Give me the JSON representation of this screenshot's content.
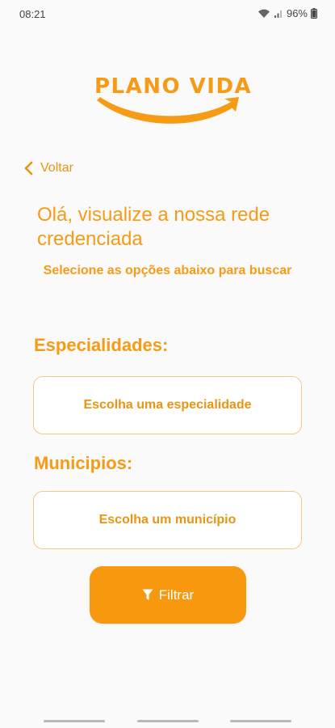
{
  "status_bar": {
    "time": "08:21",
    "battery": "96%",
    "icons": [
      "wifi-icon",
      "signal-icon",
      "battery-icon"
    ]
  },
  "logo": {
    "text": "PLANO VIDA"
  },
  "back": {
    "label": "Voltar",
    "icon": "chevron-left-icon"
  },
  "title": "Olá, visualize a nossa rede credenciada",
  "subtitle": "Selecione as opções abaixo para buscar",
  "specialty": {
    "label": "Especialidades:",
    "placeholder": "Escolha uma especialidade"
  },
  "municipality": {
    "label": "Municipios:",
    "placeholder": "Escolha um município"
  },
  "filter_button": {
    "label": "Filtrar",
    "icon": "filter-icon"
  },
  "colors": {
    "brand": "#f59b16",
    "button": "#f8980f",
    "border": "#f2c98a",
    "background": "#fafafa"
  }
}
